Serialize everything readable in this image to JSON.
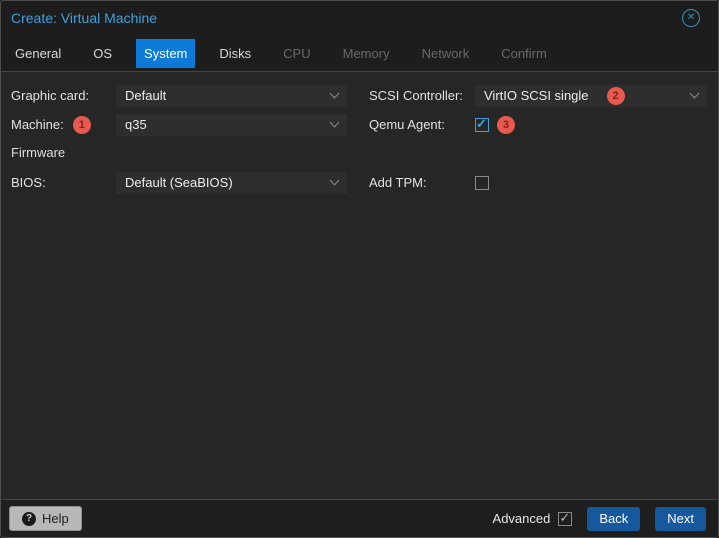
{
  "window": {
    "title": "Create: Virtual Machine",
    "close_glyph": "✕"
  },
  "tabs": {
    "items": [
      {
        "label": "General",
        "state": "enabled"
      },
      {
        "label": "OS",
        "state": "enabled"
      },
      {
        "label": "System",
        "state": "active"
      },
      {
        "label": "Disks",
        "state": "enabled"
      },
      {
        "label": "CPU",
        "state": "disabled"
      },
      {
        "label": "Memory",
        "state": "disabled"
      },
      {
        "label": "Network",
        "state": "disabled"
      },
      {
        "label": "Confirm",
        "state": "disabled"
      }
    ]
  },
  "form": {
    "graphic_card": {
      "label": "Graphic card:",
      "value": "Default"
    },
    "machine": {
      "label": "Machine:",
      "badge": "1",
      "value": "q35"
    },
    "firmware_section": {
      "label": "Firmware"
    },
    "bios": {
      "label": "BIOS:",
      "value": "Default (SeaBIOS)"
    },
    "scsi_controller": {
      "label": "SCSI Controller:",
      "value": "VirtIO SCSI single",
      "badge": "2"
    },
    "qemu_agent": {
      "label": "Qemu Agent:",
      "badge": "3",
      "checked": true
    },
    "add_tpm": {
      "label": "Add TPM:",
      "checked": false
    }
  },
  "footer": {
    "help": "Help",
    "help_icon_glyph": "?",
    "advanced": "Advanced",
    "advanced_checked": true,
    "back": "Back",
    "next": "Next"
  },
  "colors": {
    "title_blue": "#3fa0dc",
    "active_tab_blue": "#0e7ad8",
    "button_blue": "#15589e",
    "badge_red": "#e65a50",
    "checkbox_blue": "#3ca0e0",
    "body_bg": "#262626",
    "bar_bg": "#1d1d1d",
    "field_bg": "#2e2e2e"
  }
}
